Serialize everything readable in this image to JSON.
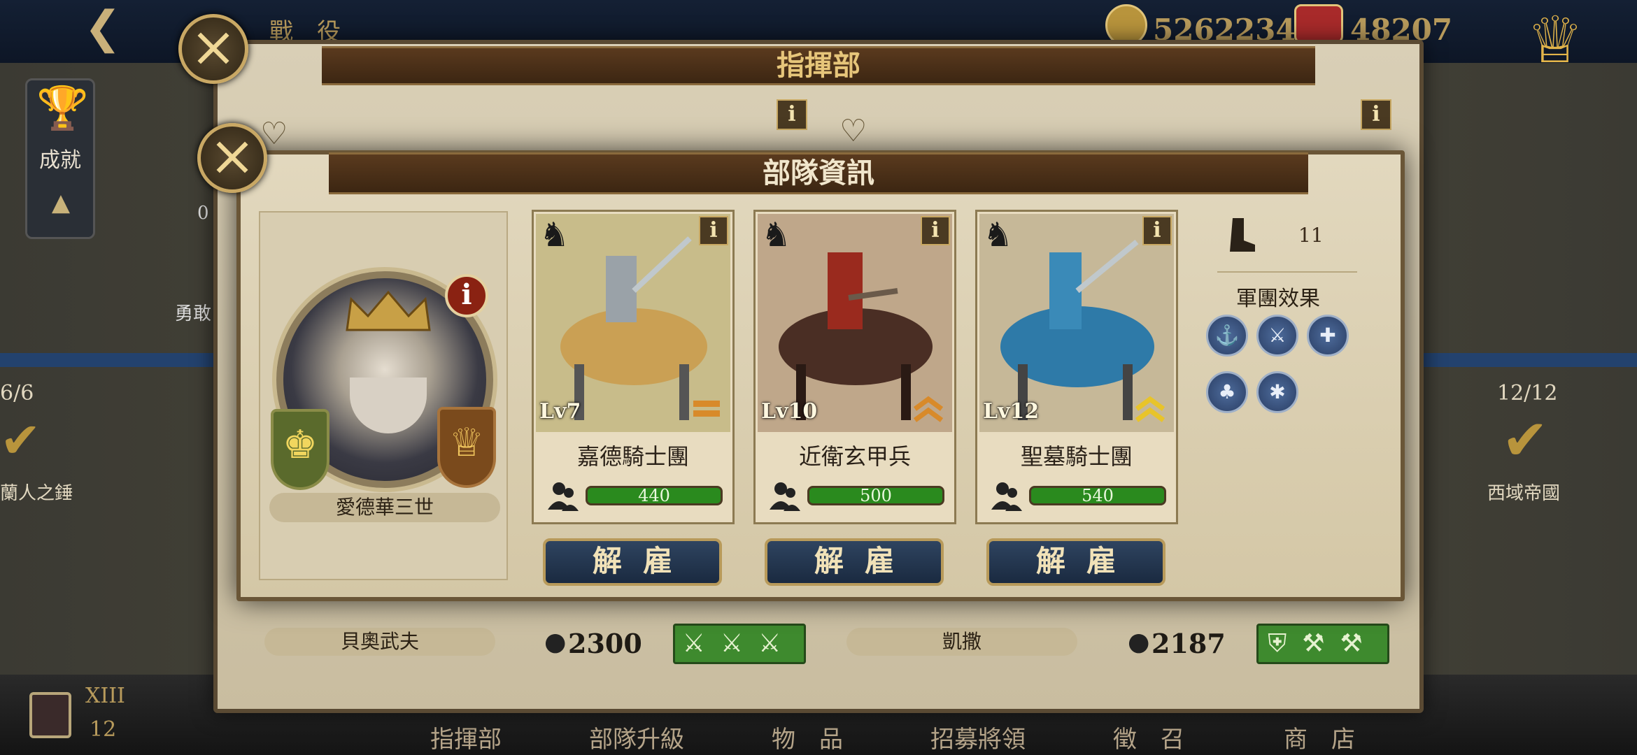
{
  "header": {
    "back_label": "戰　役",
    "currency1": "5262234",
    "currency2": "48207"
  },
  "sidebar": {
    "achievement_label": "成就",
    "left_count": "0",
    "left_hero_label": "勇敢",
    "left_progress": "6/6",
    "left_emblem_label": "蘭人之錘",
    "right_progress": "12/12",
    "right_emblem_label": "西域帝國"
  },
  "back_panel": {
    "title": "指揮部",
    "general_left_name": "貝奧武夫",
    "general_mid_name": "凱撒",
    "stat_left": "2300",
    "stat_right": "2187"
  },
  "troop_panel": {
    "title": "部隊資訊",
    "commander": {
      "name": "愛德華三世",
      "info": "i"
    },
    "troops": [
      {
        "level": "Lv7",
        "name": "嘉德騎士團",
        "count": "440",
        "info": "i",
        "dismiss": "解雇"
      },
      {
        "level": "Lv10",
        "name": "近衛玄甲兵",
        "count": "500",
        "info": "i",
        "dismiss": "解雇"
      },
      {
        "level": "Lv12",
        "name": "聖墓騎士團",
        "count": "540",
        "info": "i",
        "dismiss": "解雇"
      }
    ],
    "movement": "11",
    "legion_effect_title": "軍團效果"
  },
  "bottom_nav": {
    "save_roman": "XIII",
    "save_number": "12",
    "items": [
      "指揮部",
      "部隊升級",
      "物　品",
      "招募將領",
      "徵　召",
      "商　店"
    ]
  },
  "colors": {
    "ribbon": "#4a2f18",
    "bar_green": "#2a8a1e",
    "dismiss_blue": "#243550",
    "accent_gold": "#c9a864"
  }
}
